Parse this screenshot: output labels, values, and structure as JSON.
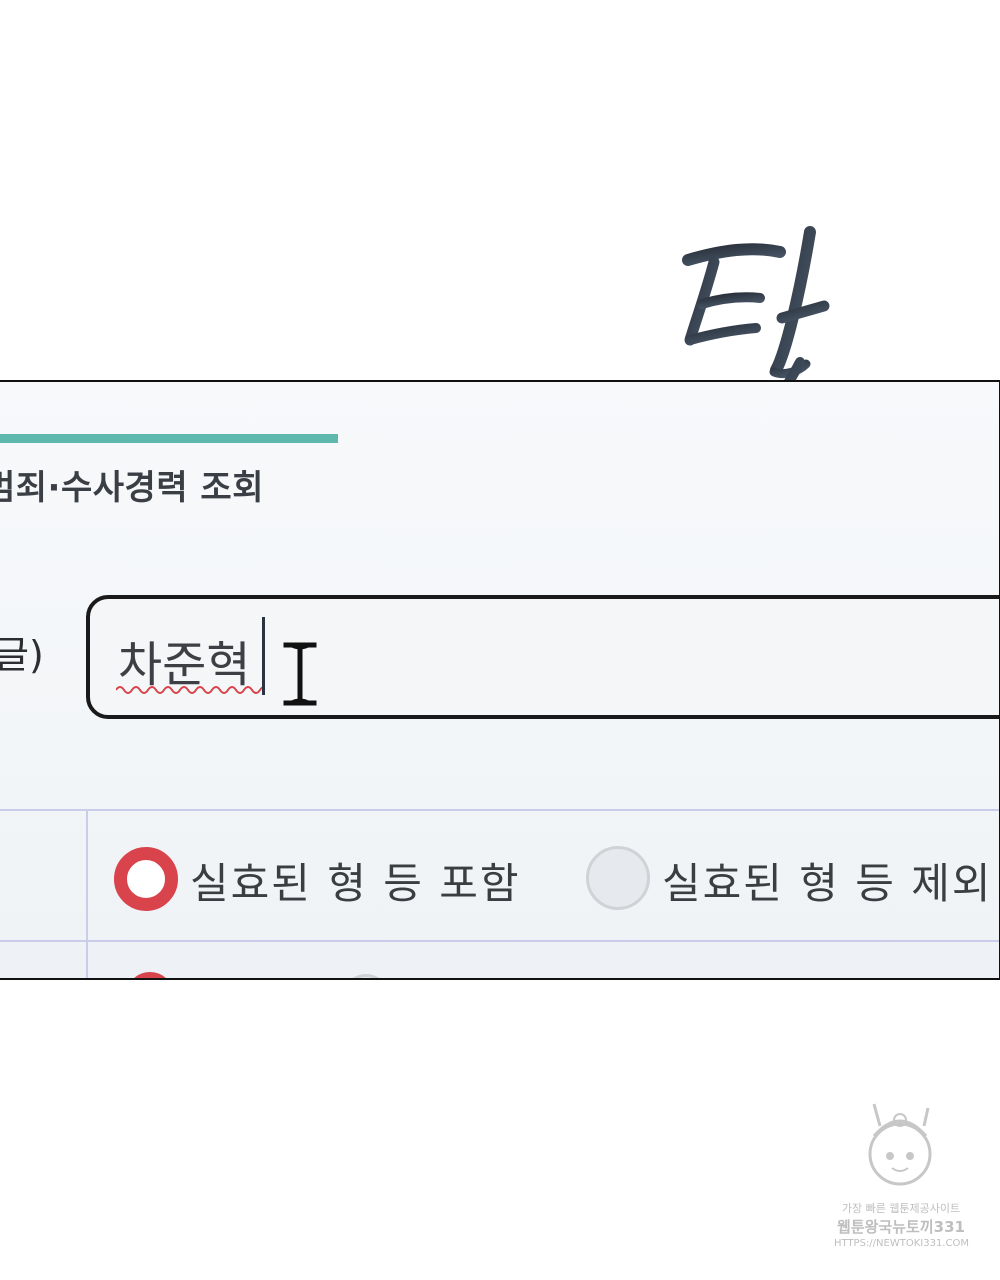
{
  "sound_effect": {
    "text": "탁",
    "color": "#2f3a47"
  },
  "screen": {
    "section_title": "범죄·수사경력 조회",
    "accent_color": "#5fb8ad",
    "name_field": {
      "label": "글)",
      "value": "차준혁",
      "spellcheck_color": "#d9434c",
      "cursor_icon": "ibeam-cursor-icon"
    },
    "options": [
      {
        "label": "실효된 형 등 포함",
        "selected": true
      },
      {
        "label": "실효된 형 등 제외",
        "selected": false
      }
    ],
    "radio_colors": {
      "selected": "#d9434c",
      "unselected": "#e6e9ed"
    }
  },
  "watermark": {
    "line1": "가장 빠른 웹툰제공사이트",
    "line2": "웹툰왕국뉴토끼331",
    "line3": "HTTPS://NEWTOKI331.COM"
  }
}
